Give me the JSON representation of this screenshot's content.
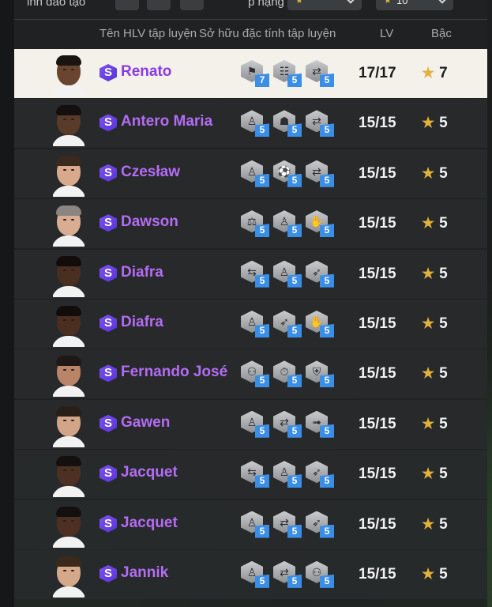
{
  "filters": {
    "training_label": "ỉnh đào tạo",
    "rank_label": "p hạng",
    "rank_value": "",
    "grade_value": "",
    "grade_value2": "10"
  },
  "columns": {
    "coach_name": "Tên HLV tập luyện",
    "traits": "Sở hữu đặc tính tập luyện",
    "level": "LV",
    "grade": "Bậc"
  },
  "colors": {
    "accent_purple": "#b46cf4",
    "selected_bg": "#f3f1ea",
    "trait_level_blue": "#3b8ee6",
    "star_gold": "#e2b13b"
  },
  "rows": [
    {
      "name": "Renato",
      "lv": "17/17",
      "grade": "7",
      "selected": true,
      "traits": [
        {
          "icon": "boot-icon",
          "level": "7"
        },
        {
          "icon": "ladder-icon",
          "level": "5"
        },
        {
          "icon": "pass-icon",
          "level": "5"
        }
      ],
      "skin": "#6b4430",
      "hair": "#1a1410"
    },
    {
      "name": "Antero Maria",
      "lv": "15/15",
      "grade": "5",
      "traits": [
        {
          "icon": "player-icon",
          "level": "5"
        },
        {
          "icon": "coach-icon",
          "level": "5"
        },
        {
          "icon": "pass-icon",
          "level": "5"
        }
      ],
      "skin": "#5a3a28",
      "hair": "#151010"
    },
    {
      "name": "Czesław",
      "lv": "15/15",
      "grade": "5",
      "traits": [
        {
          "icon": "player-icon",
          "level": "5"
        },
        {
          "icon": "ball-icon",
          "level": "5"
        },
        {
          "icon": "pass-icon",
          "level": "5"
        }
      ],
      "skin": "#d8a98c",
      "hair": "#3a2a1e"
    },
    {
      "name": "Dawson",
      "lv": "15/15",
      "grade": "5",
      "traits": [
        {
          "icon": "scale-icon",
          "level": "5"
        },
        {
          "icon": "player-icon",
          "level": "5"
        },
        {
          "icon": "keeper-icon",
          "level": "5"
        }
      ],
      "skin": "#d9ad92",
      "hair": "#8a8580"
    },
    {
      "name": "Diafra",
      "lv": "15/15",
      "grade": "5",
      "traits": [
        {
          "icon": "shuttle-icon",
          "level": "5"
        },
        {
          "icon": "player-icon",
          "level": "5"
        },
        {
          "icon": "slide-icon",
          "level": "5"
        }
      ],
      "skin": "#4a2e20",
      "hair": "#120d0a"
    },
    {
      "name": "Diafra",
      "lv": "15/15",
      "grade": "5",
      "traits": [
        {
          "icon": "player-icon",
          "level": "5"
        },
        {
          "icon": "slide-icon",
          "level": "5"
        },
        {
          "icon": "keeper-icon",
          "level": "5"
        }
      ],
      "skin": "#4a2e20",
      "hair": "#120d0a"
    },
    {
      "name": "Fernando José",
      "lv": "15/15",
      "grade": "5",
      "traits": [
        {
          "icon": "team-icon",
          "level": "5"
        },
        {
          "icon": "stopwatch-icon",
          "level": "5"
        },
        {
          "icon": "shield-icon",
          "level": "5"
        }
      ],
      "skin": "#b98468",
      "hair": "#1f1814"
    },
    {
      "name": "Gawen",
      "lv": "15/15",
      "grade": "5",
      "traits": [
        {
          "icon": "player-icon",
          "level": "5"
        },
        {
          "icon": "pass-icon",
          "level": "5"
        },
        {
          "icon": "run-icon",
          "level": "5"
        }
      ],
      "skin": "#d3a588",
      "hair": "#2a1f18"
    },
    {
      "name": "Jacquet",
      "lv": "15/15",
      "grade": "5",
      "traits": [
        {
          "icon": "shuttle-icon",
          "level": "5"
        },
        {
          "icon": "player-icon",
          "level": "5"
        },
        {
          "icon": "slide-icon",
          "level": "5"
        }
      ],
      "skin": "#4d3022",
      "hair": "#141010"
    },
    {
      "name": "Jacquet",
      "lv": "15/15",
      "grade": "5",
      "traits": [
        {
          "icon": "player-icon",
          "level": "5"
        },
        {
          "icon": "pass-icon",
          "level": "5"
        },
        {
          "icon": "slide-icon",
          "level": "5"
        }
      ],
      "skin": "#4d3022",
      "hair": "#141010"
    },
    {
      "name": "Jannik",
      "lv": "15/15",
      "grade": "5",
      "traits": [
        {
          "icon": "player-icon",
          "level": "5"
        },
        {
          "icon": "pass-icon",
          "level": "5"
        },
        {
          "icon": "team-icon",
          "level": "5"
        }
      ],
      "skin": "#d6a88a",
      "hair": "#3b2a1c"
    }
  ]
}
